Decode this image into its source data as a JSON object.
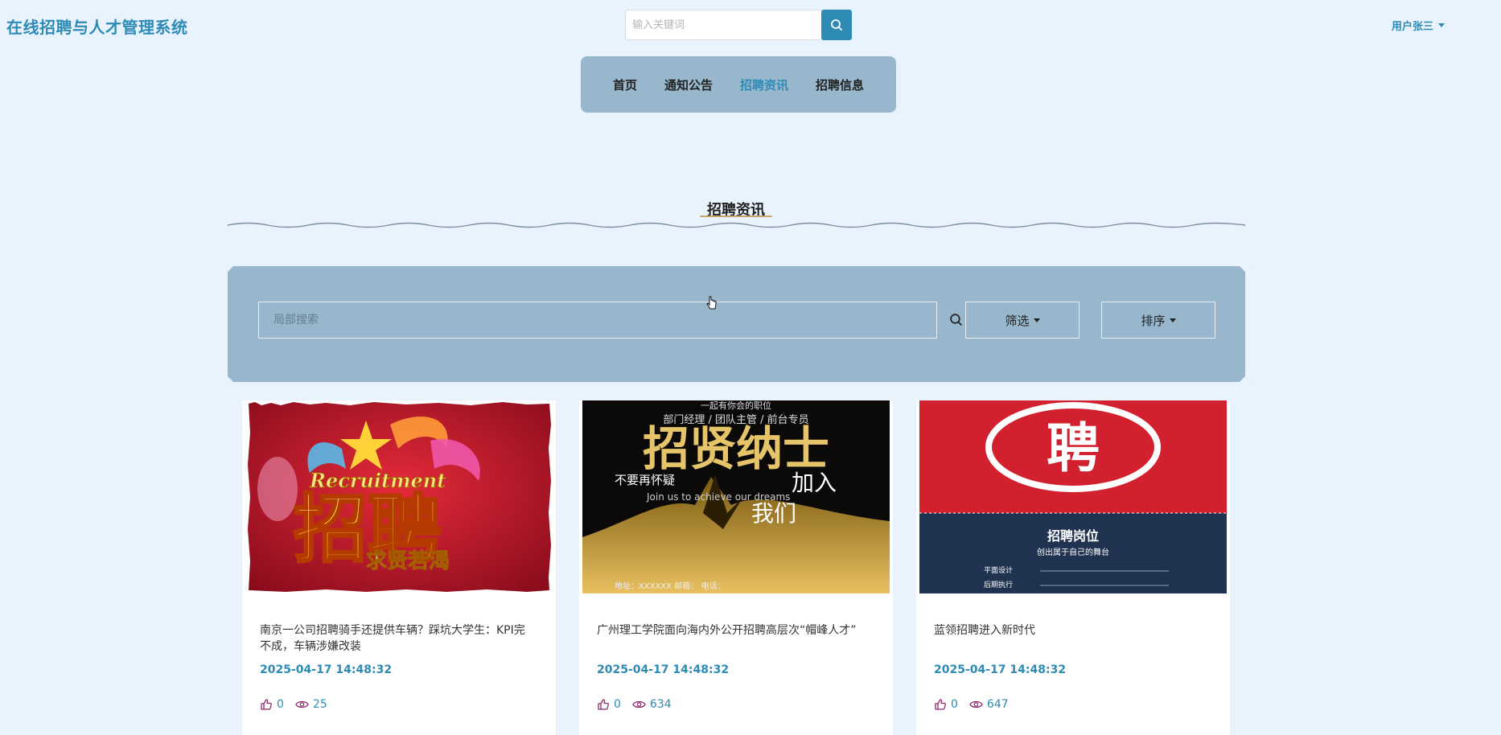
{
  "header": {
    "brand": "在线招聘与人才管理系统",
    "search_placeholder": "输入关键词",
    "user_label": "用户张三"
  },
  "nav": {
    "items": [
      {
        "label": "首页",
        "active": false
      },
      {
        "label": "通知公告",
        "active": false
      },
      {
        "label": "招聘资讯",
        "active": true
      },
      {
        "label": "招聘信息",
        "active": false
      }
    ]
  },
  "section": {
    "title": "招聘资讯"
  },
  "filter": {
    "search_placeholder": "局部搜索",
    "filter_label": "筛选",
    "sort_label": "排序"
  },
  "cards": [
    {
      "title": "南京一公司招聘骑手还提供车辆？踩坑大学生：KPI完不成，车辆涉嫌改装",
      "date": "2025-04-17 14:48:32",
      "likes": "0",
      "views": "25",
      "poster": {
        "big": "招聘",
        "en": "Recruitment",
        "sub": "求贤若渴"
      }
    },
    {
      "title": "广州理工学院面向海内外公开招聘高层次“帽峰人才”",
      "date": "2025-04-17 14:48:32",
      "likes": "0",
      "views": "634",
      "poster": {
        "top": "一起有你会的职位",
        "line": "部门经理 / 团队主管 / 前台专员",
        "big": "招贤纳士",
        "l1": "不要再怀疑",
        "join": "加入",
        "us": "我们",
        "en": "Join us to achieve our dreams",
        "foot": "地址：XXXXXX   邮箱：   电话："
      }
    },
    {
      "title": "蓝领招聘进入新时代",
      "date": "2025-04-17 14:48:32",
      "likes": "0",
      "views": "647",
      "poster": {
        "big": "聘",
        "l1": "招聘岗位",
        "l2": "创出属于自己的舞台",
        "r1": "平面设计",
        "r2": "后期执行"
      }
    }
  ],
  "colors": {
    "accent": "#2e8bb5",
    "panel": "#98b7cc",
    "background": "#e8f3fd",
    "like_icon": "#8a2a6a"
  }
}
